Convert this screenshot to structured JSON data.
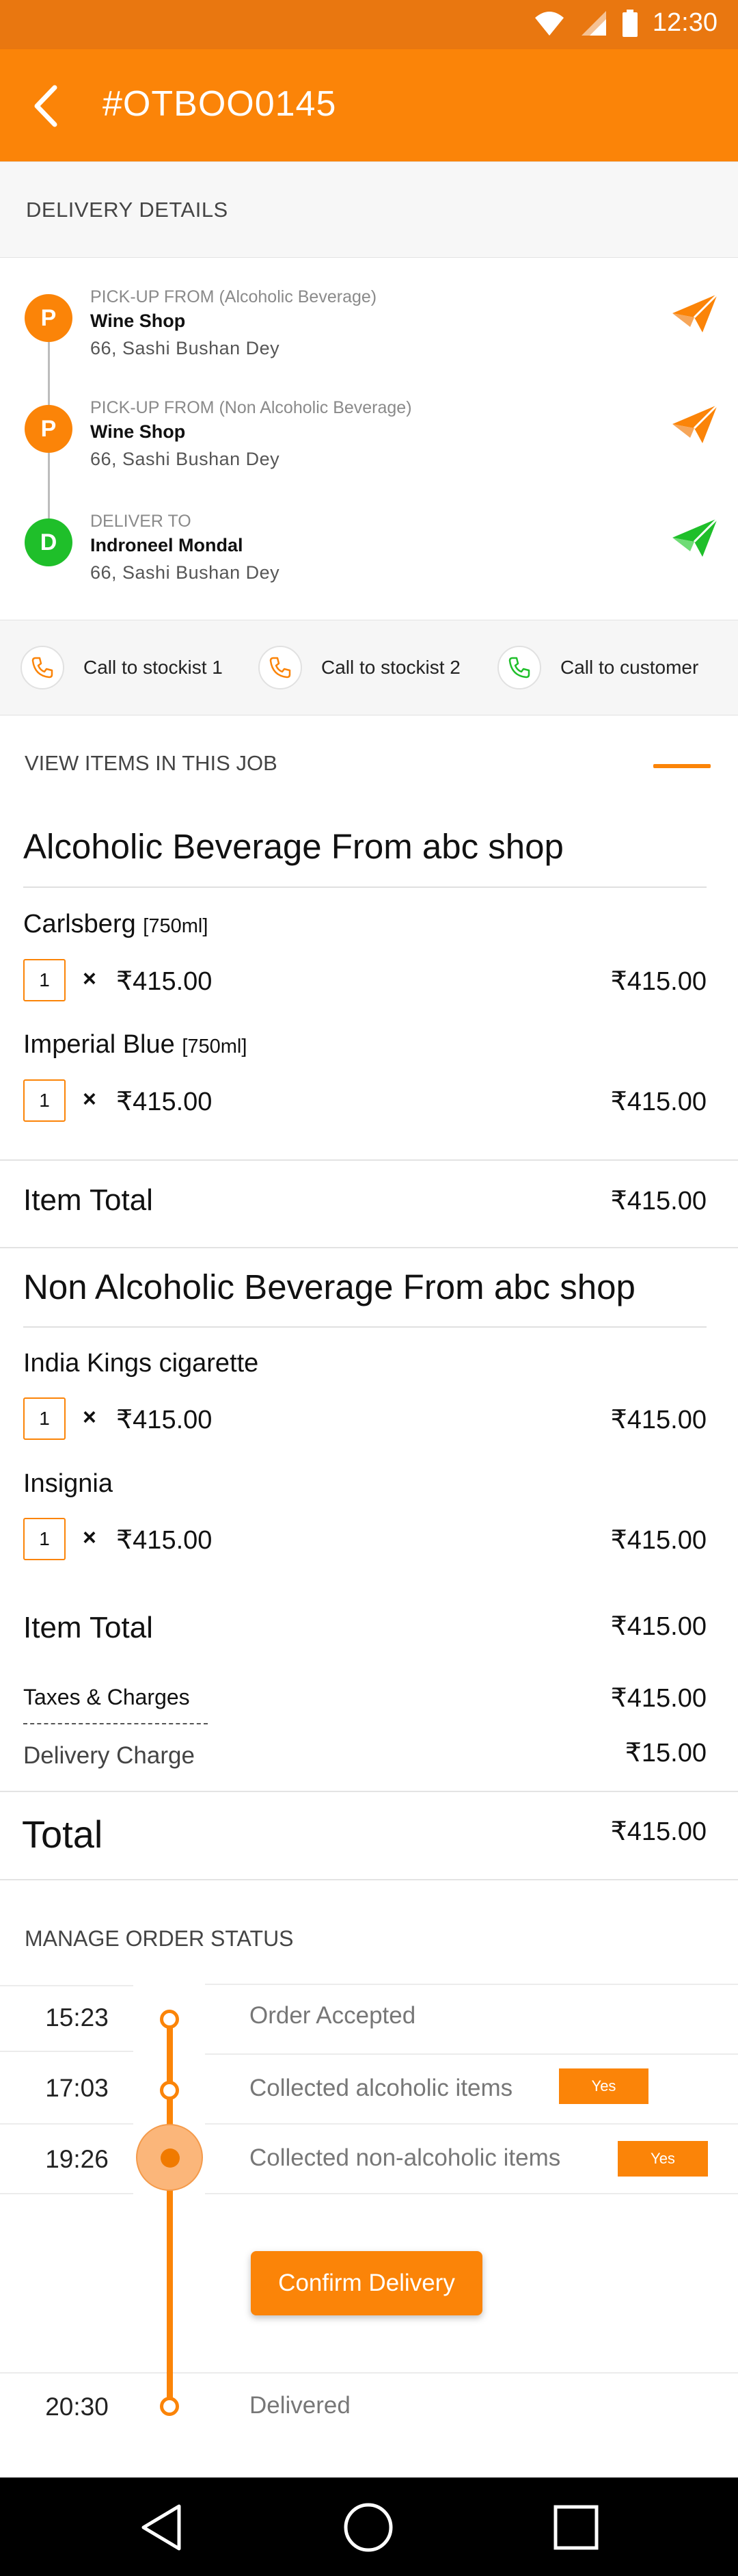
{
  "status_bar": {
    "time": "12:30"
  },
  "header": {
    "title": "#OTBOO0145"
  },
  "delivery": {
    "heading": "DELIVERY DETAILS",
    "stops": [
      {
        "badge": "P",
        "kind": "PICK-UP FROM (Alcoholic Beverage)",
        "name": "Wine Shop",
        "address": "66, Sashi Bushan Dey",
        "color": "#fb8408"
      },
      {
        "badge": "P",
        "kind": "PICK-UP FROM (Non Alcoholic Beverage)",
        "name": "Wine Shop",
        "address": "66, Sashi Bushan Dey",
        "color": "#fb8408"
      },
      {
        "badge": "D",
        "kind": "DELIVER TO",
        "name": "Indroneel Mondal",
        "address": "66, Sashi Bushan Dey",
        "color": "#1fbf2a"
      }
    ]
  },
  "calls": [
    {
      "label": "Call to stockist 1",
      "icon": "phone-icon",
      "color": "#fb8408"
    },
    {
      "label": "Call to stockist 2",
      "icon": "phone-icon",
      "color": "#fb8408"
    },
    {
      "label": "Call to customer",
      "icon": "phone-icon",
      "color": "#1fbf2a"
    }
  ],
  "items_section": {
    "heading": "VIEW ITEMS IN THIS JOB"
  },
  "groups": [
    {
      "title": "Alcoholic Beverage From abc shop",
      "items": [
        {
          "name": "Carlsberg",
          "size": "[750ml]",
          "qty": "1",
          "unit_price": "₹415.00",
          "amount": "₹415.00"
        },
        {
          "name": "Imperial Blue",
          "size": "[750ml]",
          "qty": "1",
          "unit_price": "₹415.00",
          "amount": "₹415.00"
        }
      ],
      "total_label": "Item Total",
      "total": "₹415.00"
    },
    {
      "title": "Non Alcoholic Beverage From abc shop",
      "items": [
        {
          "name": "India Kings cigarette",
          "size": "",
          "qty": "1",
          "unit_price": "₹415.00",
          "amount": "₹415.00"
        },
        {
          "name": "Insignia",
          "size": "",
          "qty": "1",
          "unit_price": "₹415.00",
          "amount": "₹415.00"
        }
      ],
      "total_label": "Item Total",
      "total": "₹415.00"
    }
  ],
  "charges": {
    "taxes_label": "Taxes & Charges",
    "taxes": "₹415.00",
    "delivery_label": "Delivery Charge",
    "delivery": "₹15.00",
    "total_label": "Total",
    "total": "₹415.00"
  },
  "order_status": {
    "heading": "MANAGE ORDER STATUS",
    "steps": [
      {
        "time": "15:23",
        "label": "Order Accepted",
        "yes": ""
      },
      {
        "time": "17:03",
        "label": "Collected alcoholic items",
        "yes": "Yes"
      },
      {
        "time": "19:26",
        "label": "Collected non-alcoholic items",
        "yes": "Yes"
      },
      {
        "time": "20:30",
        "label": "Delivered",
        "yes": ""
      }
    ],
    "confirm_label": "Confirm Delivery"
  },
  "colors": {
    "accent": "#fb8408",
    "status_bar": "#e97710",
    "success": "#1fbf2a"
  }
}
